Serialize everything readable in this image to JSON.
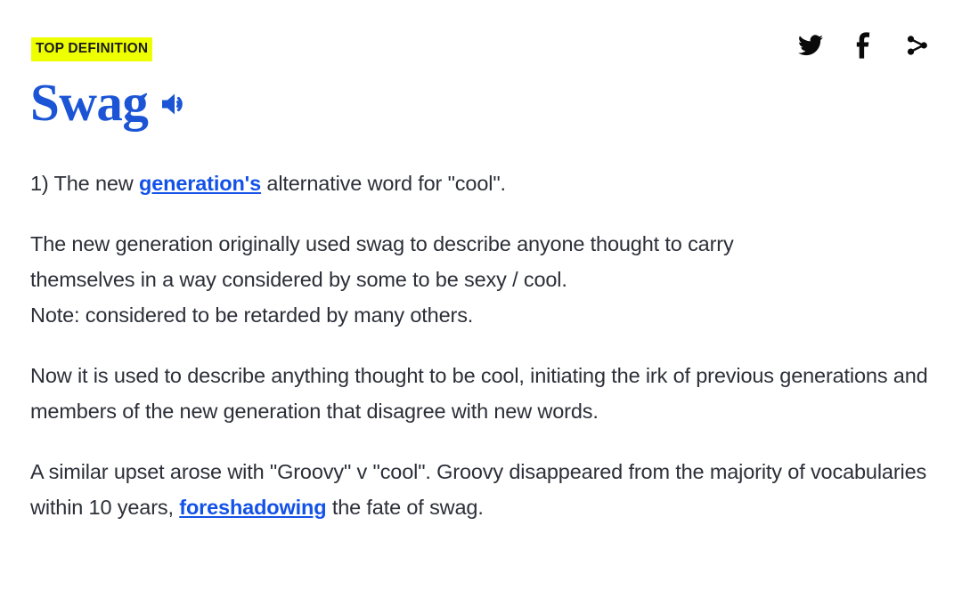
{
  "header": {
    "badge_label": "TOP DEFINITION",
    "social": [
      {
        "name": "twitter-share-icon",
        "label": "Twitter"
      },
      {
        "name": "facebook-share-icon",
        "label": "Facebook"
      },
      {
        "name": "share-icon",
        "label": "Share"
      }
    ]
  },
  "entry": {
    "word": "Swag",
    "pronounce_label": "Pronounce",
    "colors": {
      "word": "#1b55d6",
      "badge_background": "#eeff00",
      "badge_text": "#1b1b1b",
      "link": "#1352e8",
      "body_text": "#2c2f38"
    }
  },
  "definition": {
    "line1_prefix": "1) The new ",
    "line1_link": "generation's",
    "line1_suffix": " alternative word for \"cool\".",
    "paragraph2_line1": "The new generation originally used swag to describe anyone thought to carry",
    "paragraph2_line2": "themselves in a way considered by some to be sexy / cool.",
    "paragraph2_line3": "Note: considered to be retarded by many others.",
    "paragraph3": "Now it is used to describe anything thought to be cool, initiating the irk of previous generations and members of the new generation that disagree with new words.",
    "paragraph4_prefix": "A similar upset arose with \"Groovy\" v \"cool\". Groovy disappeared from the majority of vocabularies within 10 years, ",
    "paragraph4_link": "foreshadowing",
    "paragraph4_suffix": " the fate of swag."
  }
}
